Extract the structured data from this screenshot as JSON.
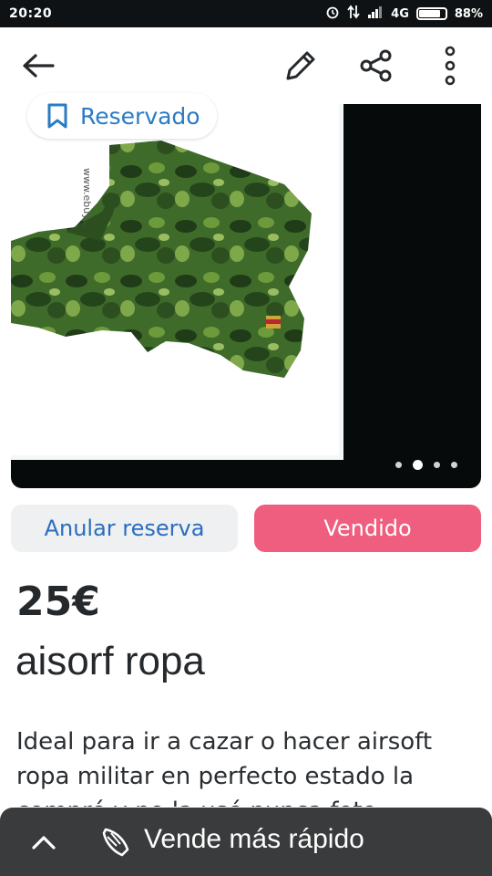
{
  "status_bar": {
    "time": "20:20",
    "network": "4G",
    "battery": "88%",
    "battery_level": 0.88
  },
  "top_bar": {
    "back_icon": "arrow-left-icon",
    "edit_icon": "pencil-icon",
    "share_icon": "share-icon",
    "more_icon": "more-vertical-icon"
  },
  "gallery": {
    "badge_label": "Reservado",
    "badge_icon": "bookmark-icon",
    "page_count": 4,
    "active_page": 2
  },
  "actions": {
    "cancel_reservation": "Anular reserva",
    "mark_sold": "Vendido"
  },
  "listing": {
    "price": "25€",
    "title": "aisorf ropa",
    "description": "Ideal para ir a cazar o hacer airsoft ropa militar en perfecto estado la compré y no la usé nunca foto..."
  },
  "bottom_bar": {
    "label": "Vende más rápido",
    "icon": "bolt-icon",
    "chevron_icon": "chevron-up-icon"
  },
  "colors": {
    "accent_pink": "#ef5d7f",
    "accent_blue": "#2a6dbf",
    "dark_bar": "#3a3b3c"
  }
}
